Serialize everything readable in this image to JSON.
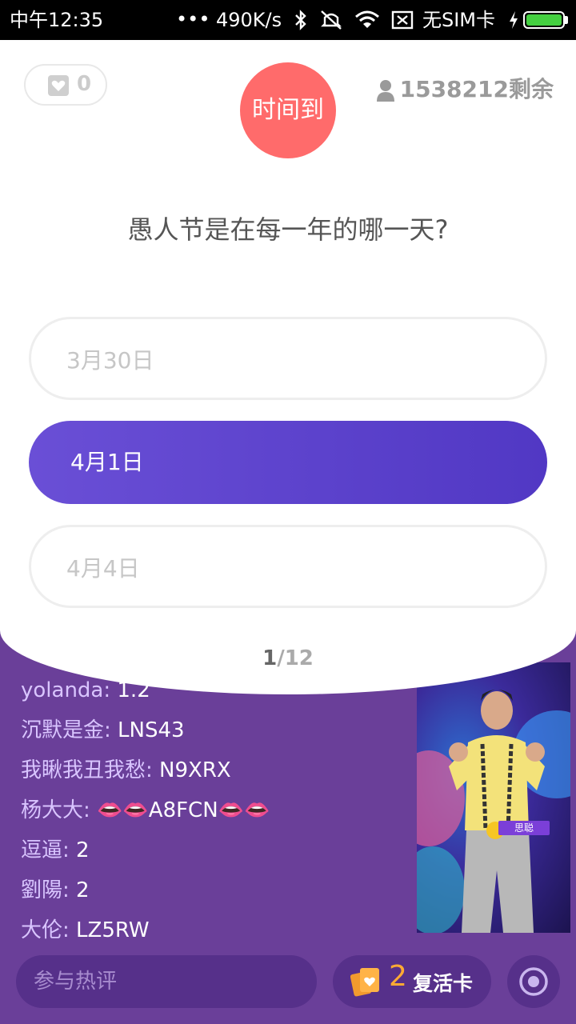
{
  "status_bar": {
    "time": "中午12:35",
    "speed": "490K/s",
    "sim": "无SIM卡",
    "icons": [
      "bluetooth-icon",
      "mute-icon",
      "wifi-icon",
      "no-sim-icon",
      "charging-icon",
      "battery-icon"
    ],
    "battery_level": 1.0
  },
  "header": {
    "hearts_count": "0",
    "timer_label": "时间到",
    "remaining": "1538212剩余"
  },
  "question": {
    "text": "愚人节是在每一年的哪一天?",
    "options": [
      {
        "label": "3月30日",
        "selected": false
      },
      {
        "label": "4月1日",
        "selected": true
      },
      {
        "label": "4月4日",
        "selected": false
      }
    ],
    "progress_current": "1",
    "progress_total": "/12"
  },
  "comments": [
    {
      "name": "yolanda:",
      "text": " 1.2"
    },
    {
      "name": "沉默是金:",
      "text": " LNS43"
    },
    {
      "name": "我瞅我丑我愁:",
      "text": " N9XRX"
    },
    {
      "name": "杨大大:",
      "text": " 👄👄A8FCN👄👄"
    },
    {
      "name": "逗逼:",
      "text": " 2"
    },
    {
      "name": "劉陽:",
      "text": " 2"
    },
    {
      "name": "大伦:",
      "text": " LZ5RW"
    }
  ],
  "video": {
    "tag": "思聪"
  },
  "bottom_bar": {
    "comment_placeholder": "参与热评",
    "revive_count": "2",
    "revive_label": "复活卡"
  },
  "colors": {
    "timer": "#ff6b6b",
    "selected_option": "#5a3fd0",
    "background": "#6a3f99",
    "revive_count": "#ffaa33"
  }
}
